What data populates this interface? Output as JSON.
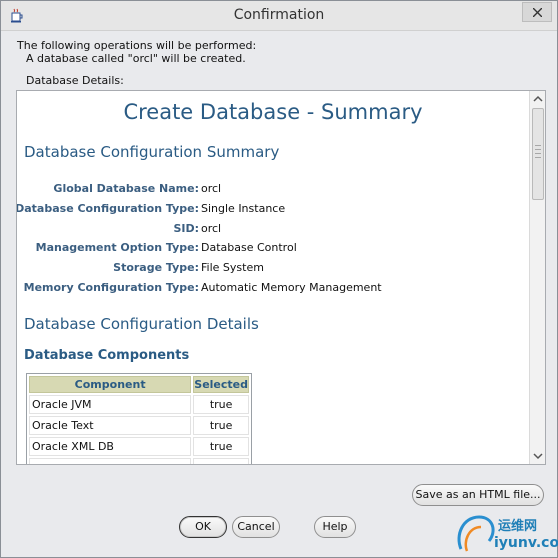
{
  "window": {
    "title": "Confirmation"
  },
  "info": {
    "line1": "The following operations will be performed:",
    "line2": "A database called \"orcl\" will be created."
  },
  "details_label": "Database Details:",
  "summary": {
    "title": "Create Database - Summary",
    "section1": "Database Configuration Summary",
    "fields": [
      {
        "key": "Global Database Name:",
        "value": "orcl"
      },
      {
        "key": "Database Configuration Type:",
        "value": "Single Instance"
      },
      {
        "key": "SID:",
        "value": "orcl"
      },
      {
        "key": "Management Option Type:",
        "value": "Database Control"
      },
      {
        "key": "Storage Type:",
        "value": "File System"
      },
      {
        "key": "Memory Configuration Type:",
        "value": "Automatic Memory Management"
      }
    ],
    "section2": "Database Configuration Details",
    "section3": "Database Components",
    "table": {
      "headers": [
        "Component",
        "Selected"
      ],
      "rows": [
        [
          "Oracle JVM",
          "true"
        ],
        [
          "Oracle Text",
          "true"
        ],
        [
          "Oracle XML DB",
          "true"
        ],
        [
          "",
          ""
        ]
      ]
    }
  },
  "buttons": {
    "save_html": "Save as an HTML file...",
    "ok": "OK",
    "cancel": "Cancel",
    "help": "Help"
  },
  "watermark": {
    "brand_cn": "运维网",
    "domain": "iyunv.com"
  },
  "icons": {
    "app": "java-cup-icon",
    "close": "close-icon",
    "scroll_up": "scroll-up-arrow-icon",
    "scroll_down": "scroll-down-arrow-icon"
  },
  "colors": {
    "heading": "#2a5b84",
    "table_header_bg": "#d7d9b3",
    "field_label": "#3b5e80"
  }
}
